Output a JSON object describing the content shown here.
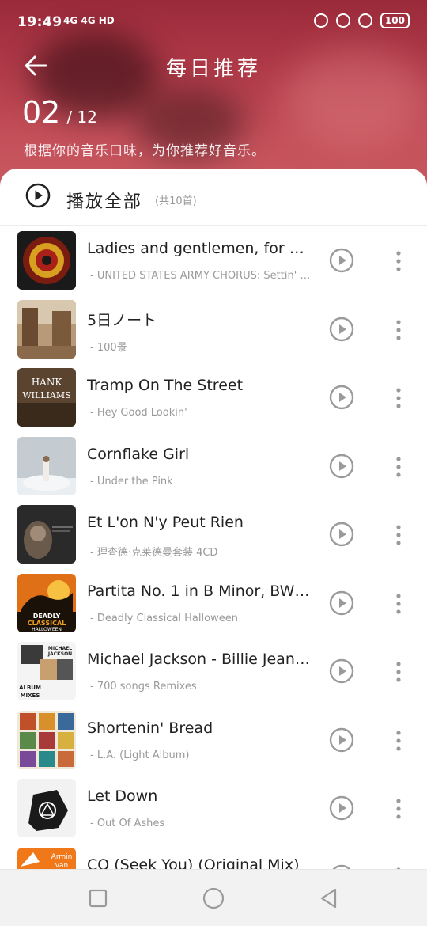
{
  "status_bar": {
    "time": "19:49",
    "network": "4G 4G HD",
    "battery": "100"
  },
  "header": {
    "title": "每日推荐",
    "day": "02",
    "month": "/ 12",
    "subtitle": "根据你的音乐口味，为你推荐好音乐。"
  },
  "play_all": {
    "label": "播放全部",
    "count": "(共10首)"
  },
  "songs": [
    {
      "title": "Ladies and gentlemen, for over …",
      "subtitle": "- UNITED STATES ARMY  CHORUS: Settin' th …",
      "cover_color": "#7a1c10"
    },
    {
      "title": "5日ノート",
      "subtitle": "- 100景",
      "cover_color": "#9a7a5a"
    },
    {
      "title": "Tramp On The Street",
      "subtitle": "- Hey Good Lookin'",
      "cover_color": "#6a5238"
    },
    {
      "title": "Cornflake Girl",
      "subtitle": "- Under the Pink",
      "cover_color": "#b9c4cc"
    },
    {
      "title": "Et L'on N'y Peut Rien",
      "subtitle": "- 理查德·克莱德曼套装 4CD",
      "cover_color": "#2e2e2e"
    },
    {
      "title": "Partita No. 1 in B Minor, BWV  …",
      "subtitle": "- Deadly Classical Halloween",
      "cover_color": "#d8601a"
    },
    {
      "title": "Michael Jackson - Billie Jean ( …",
      "subtitle": "- 700 songs Remixes",
      "cover_color": "#e8e8e8"
    },
    {
      "title": "Shortenin' Bread",
      "subtitle": "- L.A. (Light Album)",
      "cover_color": "#c0502a"
    },
    {
      "title": "Let Down",
      "subtitle": "- Out Of Ashes",
      "cover_color": "#f0f0f0"
    },
    {
      "title": "CQ (Seek You) (Original Mix)",
      "subtitle": "",
      "cover_color": "#f07818"
    }
  ],
  "cover_texts": {
    "hank": "HANK",
    "williams": "WILLIAMS",
    "deadly": "DEADLY",
    "classical": "CLASSICAL",
    "halloween": "HALLOWEEN",
    "michael": "MICHAEL",
    "jackson": "JACKSON",
    "album": "ALBUM",
    "mixes": "MIXES",
    "armin": "Armin",
    "van": "van"
  },
  "colors": {
    "accent": "#b03a48",
    "text_primary": "#222222",
    "text_secondary": "#999999",
    "icon_gray": "#9a9a9a"
  }
}
